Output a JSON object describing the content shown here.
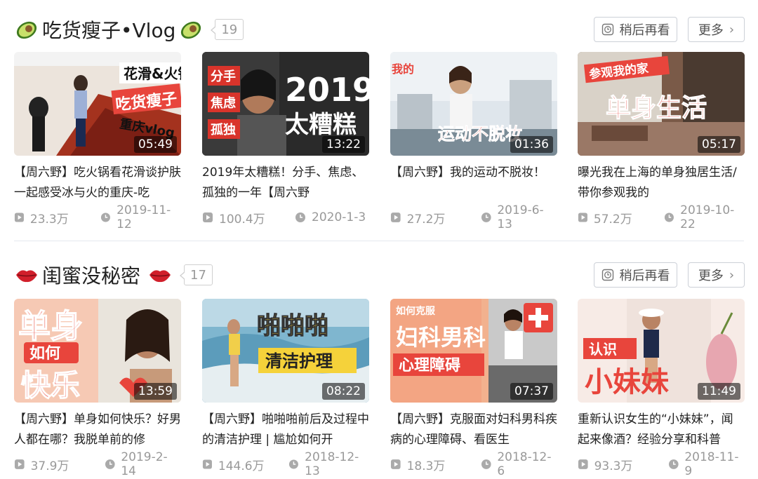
{
  "sections": [
    {
      "title": "吃货瘦子•Vlog",
      "count": "19",
      "emoji": "avocado-icon",
      "later_label": "稍后再看",
      "more_label": "更多",
      "videos": [
        {
          "title": "【周六野】吃火锅看花滑谈护肤 一起感受冰与火的重庆-吃",
          "duration": "05:49",
          "views": "23.3万",
          "date": "2019-11-12",
          "thumb_text": [
            "花滑&火锅",
            "吃货瘦子",
            "重庆vlog"
          ]
        },
        {
          "title": "2019年太糟糕！分手、焦虑、孤独的一年【周六野",
          "duration": "13:22",
          "views": "100.4万",
          "date": "2020-1-3",
          "thumb_text": [
            "分手",
            "焦虑",
            "孤独",
            "2019",
            "太糟糕"
          ]
        },
        {
          "title": "【周六野】我的运动不脱妆！",
          "duration": "01:36",
          "views": "27.2万",
          "date": "2019-6-13",
          "thumb_text": [
            "我的",
            "运动不脱妆"
          ]
        },
        {
          "title": "曝光我在上海的单身独居生活/带你参观我的",
          "duration": "05:17",
          "views": "57.2万",
          "date": "2019-10-22",
          "thumb_text": [
            "参观我的家",
            "单身生活"
          ]
        }
      ]
    },
    {
      "title": "闺蜜没秘密",
      "count": "17",
      "emoji": "lips-icon",
      "later_label": "稍后再看",
      "more_label": "更多",
      "videos": [
        {
          "title": "【周六野】单身如何快乐？好男人都在哪？我脱单前的修",
          "duration": "13:59",
          "views": "37.9万",
          "date": "2019-2-14",
          "thumb_text": [
            "单身",
            "如何",
            "快乐"
          ]
        },
        {
          "title": "【周六野】啪啪啪前后及过程中的清洁护理 | 尴尬如何开",
          "duration": "08:22",
          "views": "144.6万",
          "date": "2018-12-13",
          "thumb_text": [
            "啪啪啪",
            "清洁护理"
          ]
        },
        {
          "title": "【周六野】克服面对妇科男科疾病的心理障碍、看医生",
          "duration": "07:37",
          "views": "18.3万",
          "date": "2018-12-6",
          "thumb_text": [
            "如何克服",
            "妇科男科",
            "心理障碍"
          ]
        },
        {
          "title": "重新认识女生的“小妹妹”，闻起来像酒？经验分享和科普",
          "duration": "11:49",
          "views": "93.3万",
          "date": "2018-11-9",
          "thumb_text": [
            "认识",
            "小妹妹"
          ]
        }
      ]
    }
  ],
  "colors": {
    "accent_red": "#e8453c",
    "meta_gray": "#999999",
    "border": "#ccd0d7"
  }
}
